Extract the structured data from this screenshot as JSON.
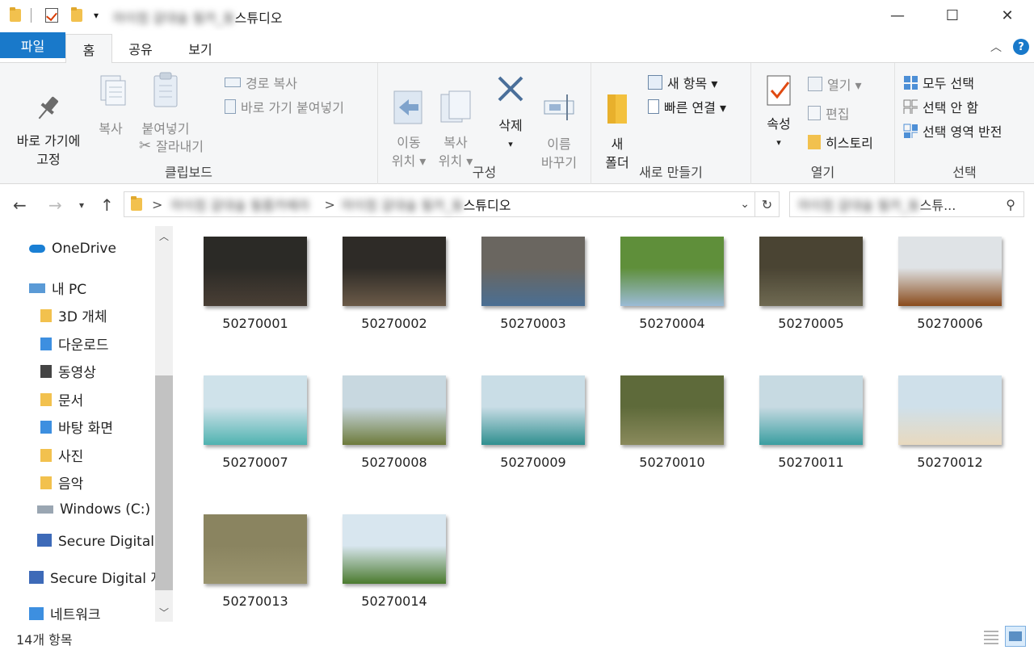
{
  "window": {
    "title_blurred": "마이컴 갈대숲 필카_동",
    "title_tail": "스튜디오",
    "min": "—",
    "max": "☐",
    "close": "✕"
  },
  "tabs": {
    "file": "파일",
    "home": "홈",
    "share": "공유",
    "view": "보기"
  },
  "ribbon": {
    "clipboard": {
      "label": "클립보드",
      "pin": "바로 가기에\n고정",
      "copy": "복사",
      "paste": "붙여넣기",
      "copy_path": "경로 복사",
      "paste_shortcut": "바로 가기 붙여넣기",
      "cut": "잘라내기"
    },
    "organize": {
      "label": "구성",
      "move": "이동\n위치 ▾",
      "copyto": "복사\n위치 ▾",
      "delete": "삭제",
      "delete_arrow": "▾",
      "rename": "이름\n바꾸기"
    },
    "new": {
      "label": "새로 만들기",
      "new_folder": "새\n폴더",
      "new_item": "새 항목 ▾",
      "easy_access": "빠른 연결 ▾"
    },
    "open": {
      "label": "열기",
      "properties": "속성",
      "properties_arrow": "▾",
      "open": "열기 ▾",
      "edit": "편집",
      "history": "히스토리"
    },
    "select": {
      "label": "선택",
      "select_all": "모두 선택",
      "select_none": "선택 안 함",
      "invert": "선택 영역 반전"
    }
  },
  "address": {
    "crumb1_blurred": "마이컴 갈대숲 필름카메라",
    "crumb2_blurred": "마이컴 갈대숲 필카_동",
    "crumb2_tail": "스튜디오",
    "search_blurred": "마이컴 갈대숲 필카_동",
    "search_tail": "스튜...",
    "separator": ">"
  },
  "nav": {
    "onedrive": "OneDrive",
    "pc": "내 PC",
    "objects3d": "3D 개체",
    "downloads": "다운로드",
    "videos": "동영상",
    "documents": "문서",
    "desktop": "바탕 화면",
    "pictures": "사진",
    "music": "음악",
    "windows_c": "Windows (C:)",
    "sd1": "Secure Digital 저",
    "sd2": "Secure Digital 저",
    "network": "네트워크"
  },
  "files": [
    {
      "name": "50270001",
      "c1": "#2b2a26",
      "c2": "#4a3f35"
    },
    {
      "name": "50270002",
      "c1": "#2e2b27",
      "c2": "#6b5a48"
    },
    {
      "name": "50270003",
      "c1": "#6a6660",
      "c2": "#4a6f94"
    },
    {
      "name": "50270004",
      "c1": "#5f8f3a",
      "c2": "#9bbbd6"
    },
    {
      "name": "50270005",
      "c1": "#4a4433",
      "c2": "#6f6a52"
    },
    {
      "name": "50270006",
      "c1": "#dfe3e6",
      "c2": "#8a4b1c"
    },
    {
      "name": "50270007",
      "c1": "#cfe2ea",
      "c2": "#4fb3b0"
    },
    {
      "name": "50270008",
      "c1": "#c8d8e0",
      "c2": "#6d7a3a"
    },
    {
      "name": "50270009",
      "c1": "#c9dde6",
      "c2": "#2f8f8f"
    },
    {
      "name": "50270010",
      "c1": "#5e6a3a",
      "c2": "#8a8a5c"
    },
    {
      "name": "50270011",
      "c1": "#c7dae2",
      "c2": "#3a9ea0"
    },
    {
      "name": "50270012",
      "c1": "#cfe0ea",
      "c2": "#e8d9bf"
    },
    {
      "name": "50270013",
      "c1": "#8a8460",
      "c2": "#9a946e"
    },
    {
      "name": "50270014",
      "c1": "#d8e6ef",
      "c2": "#4a7a2e"
    }
  ],
  "status": {
    "count": "14개 항목"
  }
}
